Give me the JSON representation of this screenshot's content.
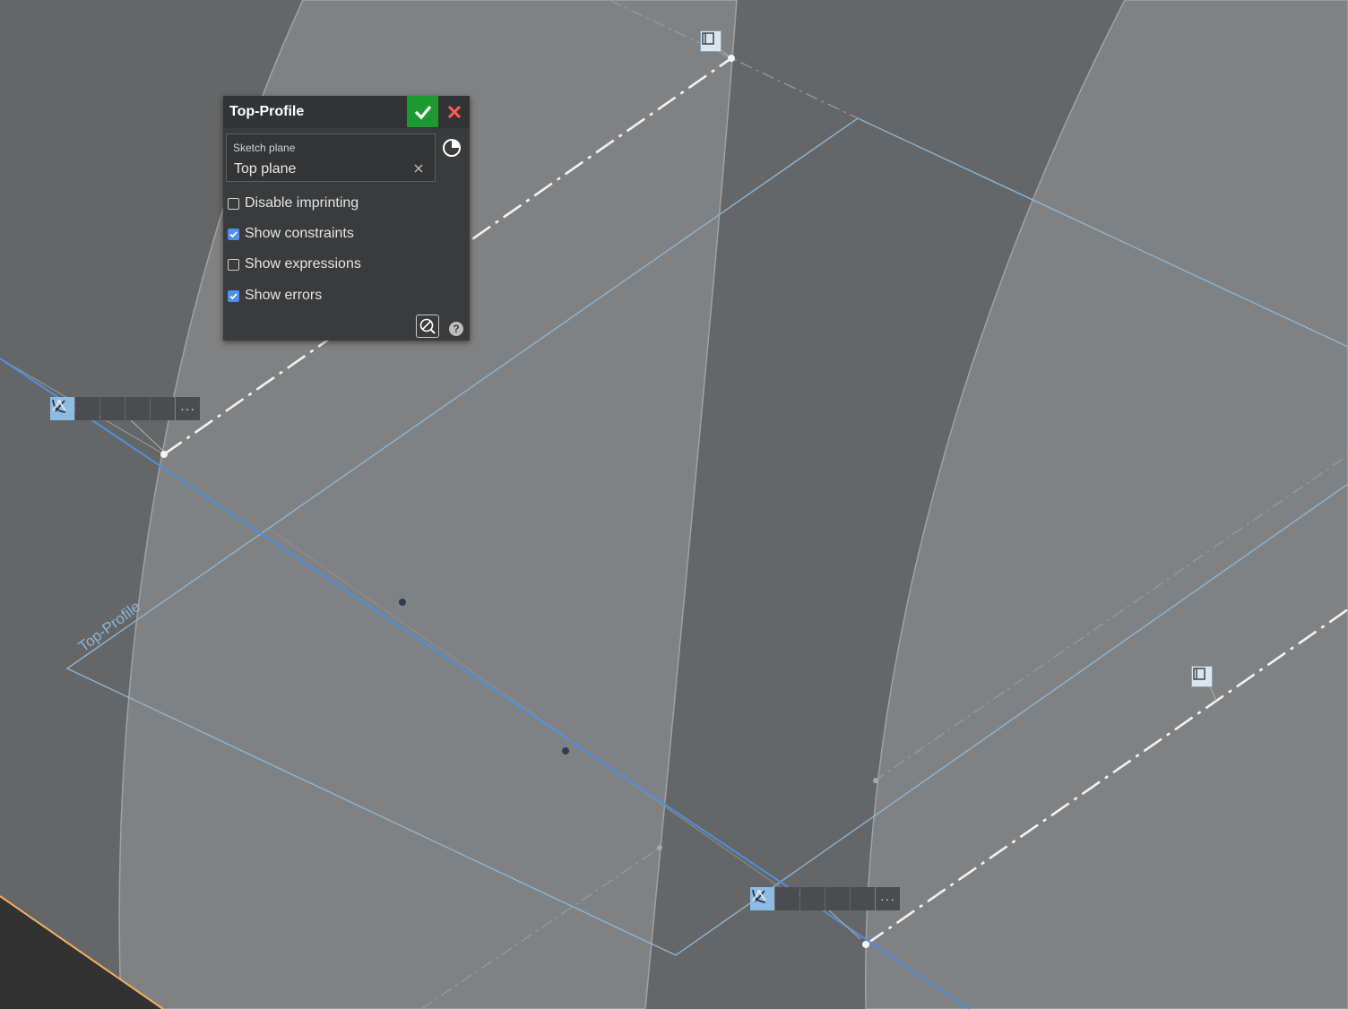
{
  "dialog": {
    "title": "Top-Profile",
    "sketch_plane_label": "Sketch plane",
    "sketch_plane_value": "Top plane",
    "options": [
      {
        "label": "Disable imprinting",
        "checked": false
      },
      {
        "label": "Show constraints",
        "checked": true
      },
      {
        "label": "Show expressions",
        "checked": false
      },
      {
        "label": "Show errors",
        "checked": true
      }
    ],
    "help_label": "?",
    "icons": {
      "confirm": "check-icon",
      "cancel": "close-icon",
      "clear": "clear-x-icon",
      "view": "pie-view-icon",
      "inspect": "sketch-inspect-icon"
    }
  },
  "viewport": {
    "plane_label": "Top-Profile",
    "constraint_bars": [
      {
        "icons": [
          "tangent-icon",
          "coincident-icon",
          "coincident-icon",
          "coincident-icon",
          "coincident-icon"
        ],
        "more": "···"
      },
      {
        "icons": [
          "tangent-icon",
          "coincident-icon",
          "coincident-icon",
          "coincident-icon",
          "coincident-icon"
        ],
        "more": "···"
      }
    ]
  },
  "colors": {
    "accept": "#1d9a2f",
    "cancel_x": "#ff5c5c",
    "checkbox": "#4d8ef0",
    "sketch_line": "#4a90e2",
    "plane_outline": "#8bb4d4",
    "edge_highlight": "#f0b060"
  }
}
